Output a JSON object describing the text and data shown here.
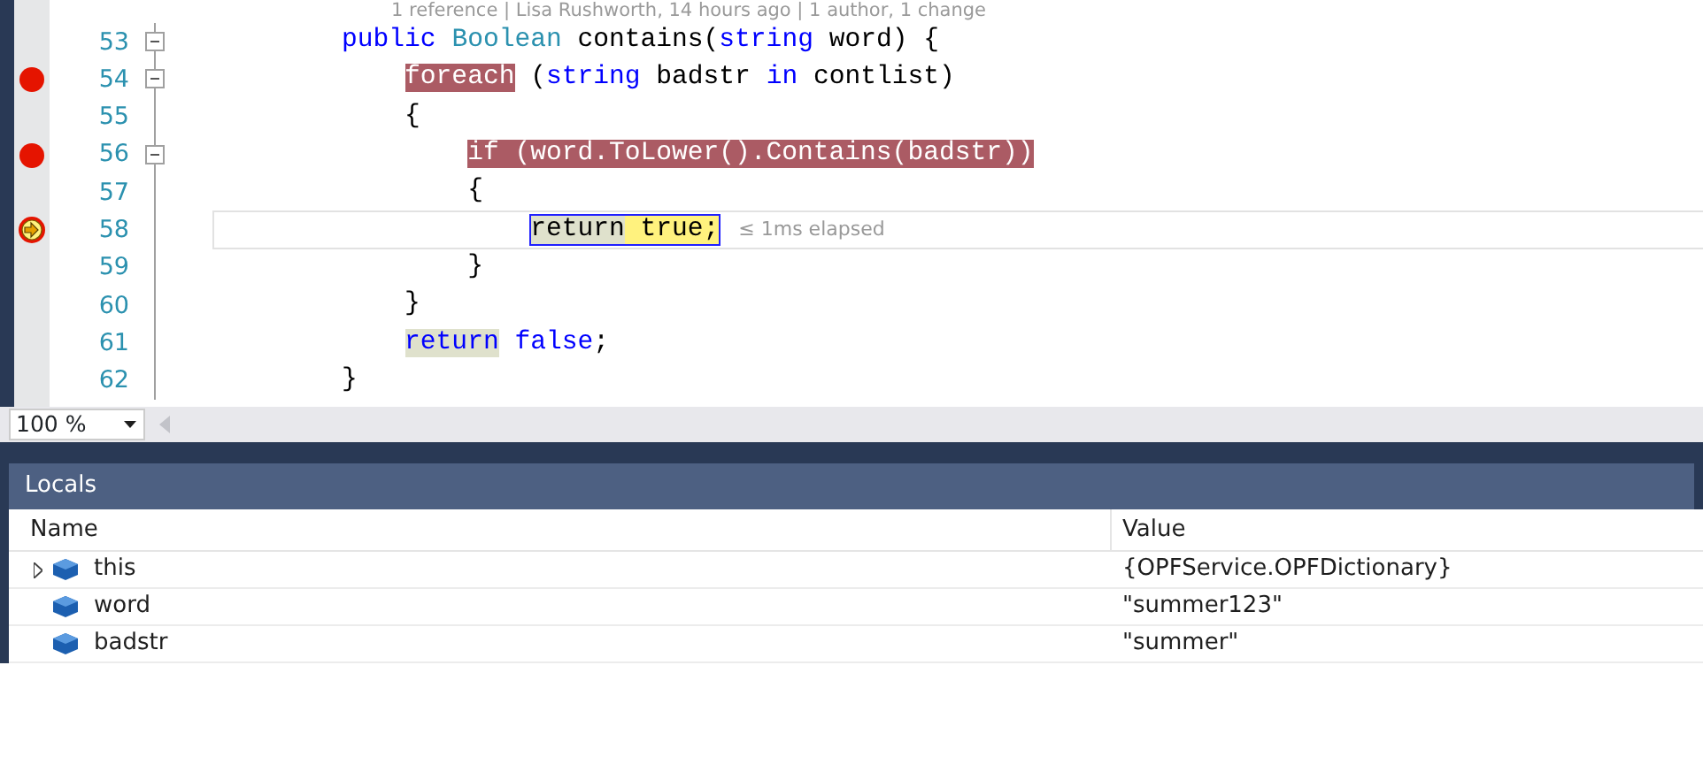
{
  "editor": {
    "codelens": "1 reference | Lisa Rushworth, 14 hours ago | 1 author, 1 change",
    "lines": [
      {
        "number": "53",
        "breakpoint": false,
        "execution_point": false,
        "foldable": true,
        "current": false,
        "segments": [
          {
            "text": "public ",
            "kind": "keyword"
          },
          {
            "text": "Boolean",
            "kind": "type"
          },
          {
            "text": " contains("
          },
          {
            "text": "string",
            "kind": "keyword"
          },
          {
            "text": " word) {"
          }
        ],
        "children": [
          {
            "number": "54",
            "breakpoint": true,
            "execution_point": false,
            "foldable": true,
            "current": false,
            "segments": [
              {
                "text": "foreach",
                "breakpoint_highlight": true
              },
              {
                "text": " ("
              },
              {
                "text": "string",
                "kind": "keyword"
              },
              {
                "text": " badstr "
              },
              {
                "text": "in",
                "kind": "keyword"
              },
              {
                "text": " contlist)"
              }
            ]
          },
          {
            "number": "55",
            "breakpoint": false,
            "execution_point": false,
            "foldable": false,
            "current": false,
            "segments": [
              {
                "text": "{"
              }
            ],
            "children": [
              {
                "number": "56",
                "breakpoint": true,
                "execution_point": false,
                "foldable": true,
                "current": false,
                "segments": [
                  {
                    "text": "if (word.ToLower().Contains(badstr))",
                    "breakpoint_highlight": true
                  }
                ]
              },
              {
                "number": "57",
                "breakpoint": false,
                "execution_point": false,
                "foldable": false,
                "current": false,
                "segments": [
                  {
                    "text": "{"
                  }
                ],
                "children": [
                  {
                    "number": "58",
                    "breakpoint": false,
                    "execution_point": true,
                    "foldable": false,
                    "current": true,
                    "perf_tip": "≤ 1ms elapsed",
                    "segments": [
                      {
                        "text": "return",
                        "reference_highlight": true
                      },
                      {
                        "text": " true;",
                        "current_statement": true
                      }
                    ]
                  }
                ]
              },
              {
                "number": "59",
                "breakpoint": false,
                "execution_point": false,
                "foldable": false,
                "current": false,
                "segments": [
                  {
                    "text": "}"
                  }
                ]
              }
            ]
          },
          {
            "number": "60",
            "breakpoint": false,
            "execution_point": false,
            "foldable": false,
            "current": false,
            "segments": [
              {
                "text": "}"
              }
            ]
          },
          {
            "number": "61",
            "breakpoint": false,
            "execution_point": false,
            "foldable": false,
            "current": false,
            "segments": [
              {
                "text": "return",
                "kind": "keyword",
                "reference_highlight": true
              },
              {
                "text": " false",
                "kind": "keyword"
              },
              {
                "text": ";"
              }
            ]
          }
        ]
      },
      {
        "number": "62",
        "breakpoint": false,
        "execution_point": false,
        "foldable": false,
        "current": false,
        "segments": [
          {
            "text": "}"
          }
        ]
      }
    ],
    "zoom": "100 %"
  },
  "locals": {
    "title": "Locals",
    "columns": [
      "Name",
      "Value"
    ],
    "rows": [
      {
        "name": "this",
        "value": "{OPFService.OPFDictionary}",
        "expandable": true
      },
      {
        "name": "word",
        "value": "\"summer123\"",
        "expandable": false
      },
      {
        "name": "badstr",
        "value": "\"summer\"",
        "expandable": false
      }
    ]
  }
}
